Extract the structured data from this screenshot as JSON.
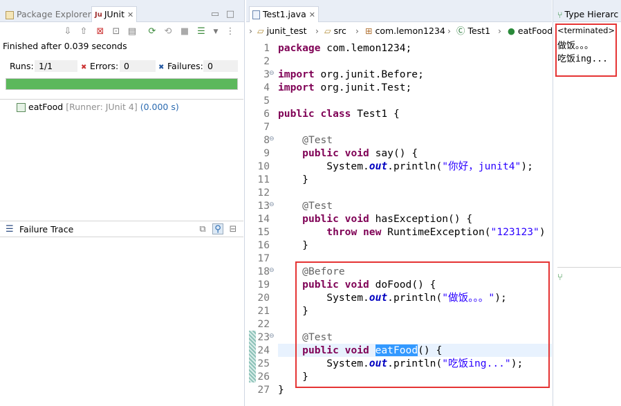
{
  "left_panel": {
    "tabs": {
      "package_explorer": "Package Explorer",
      "junit": "JUnit"
    },
    "status": "Finished after 0.039 seconds",
    "runs_label": "Runs:",
    "runs_value": "1/1",
    "errors_label": "Errors:",
    "errors_value": "0",
    "failures_label": "Failures:",
    "failures_value": "0",
    "progress": 1.0,
    "progress_color": "#5cb85c",
    "test_item": {
      "name": "eatFood",
      "details": "[Runner: JUnit 4]",
      "time": "(0.000 s)"
    },
    "failure_trace_label": "Failure Trace"
  },
  "editor": {
    "tab_label": "Test1.java",
    "breadcrumb": [
      "junit_test",
      "src",
      "com.lemon1234",
      "Test1",
      "eatFood"
    ],
    "lines": [
      {
        "n": "1",
        "html": "<span class='kw'>package</span> com.lemon1234;"
      },
      {
        "n": "2",
        "html": ""
      },
      {
        "n": "3",
        "html": "<span class='kw'>import</span> org.junit.Before;"
      },
      {
        "n": "4",
        "html": "<span class='kw'>import</span> org.junit.Test;"
      },
      {
        "n": "5",
        "html": ""
      },
      {
        "n": "6",
        "html": "<span class='kw'>public class</span> Test1 {"
      },
      {
        "n": "7",
        "html": ""
      },
      {
        "n": "8",
        "html": "    <span class='ann'>@Test</span>"
      },
      {
        "n": "9",
        "html": "    <span class='kw'>public void</span> say() {"
      },
      {
        "n": "10",
        "html": "        System.<span class='fld'>out</span>.println(<span class='str'>\"你好，junit4\"</span>);"
      },
      {
        "n": "11",
        "html": "    }"
      },
      {
        "n": "12",
        "html": ""
      },
      {
        "n": "13",
        "html": "    <span class='ann'>@Test</span>"
      },
      {
        "n": "14",
        "html": "    <span class='kw'>public void</span> hasException() {"
      },
      {
        "n": "15",
        "html": "        <span class='kw'>throw new</span> RuntimeException(<span class='str'>\"123123\"</span>)"
      },
      {
        "n": "16",
        "html": "    }"
      },
      {
        "n": "17",
        "html": ""
      },
      {
        "n": "18",
        "html": "    <span class='ann'>@Before</span>"
      },
      {
        "n": "19",
        "html": "    <span class='kw'>public void</span> doFood() {"
      },
      {
        "n": "20",
        "html": "        System.<span class='fld'>out</span>.println(<span class='str'>\"做饭。。。\"</span>);"
      },
      {
        "n": "21",
        "html": "    }"
      },
      {
        "n": "22",
        "html": ""
      },
      {
        "n": "23",
        "html": "    <span class='ann'>@Test</span>"
      },
      {
        "n": "24",
        "html": "    <span class='kw'>public void</span> <span class='sel'>eatFood</span>() {"
      },
      {
        "n": "25",
        "html": "        System.<span class='fld'>out</span>.println(<span class='str'>\"吃饭ing...\"</span>);"
      },
      {
        "n": "26",
        "html": "    }"
      },
      {
        "n": "27",
        "html": "}"
      }
    ]
  },
  "right_panel": {
    "tab_label": "Type Hierarc",
    "console_title": "<terminated>",
    "console_lines": [
      "做饭。。。",
      "吃饭ing..."
    ]
  },
  "colors": {
    "keyword": "#7f0055",
    "string": "#2a00ff",
    "annotation": "#646464",
    "highlight_box": "#e53333",
    "selection": "#3399ff"
  }
}
